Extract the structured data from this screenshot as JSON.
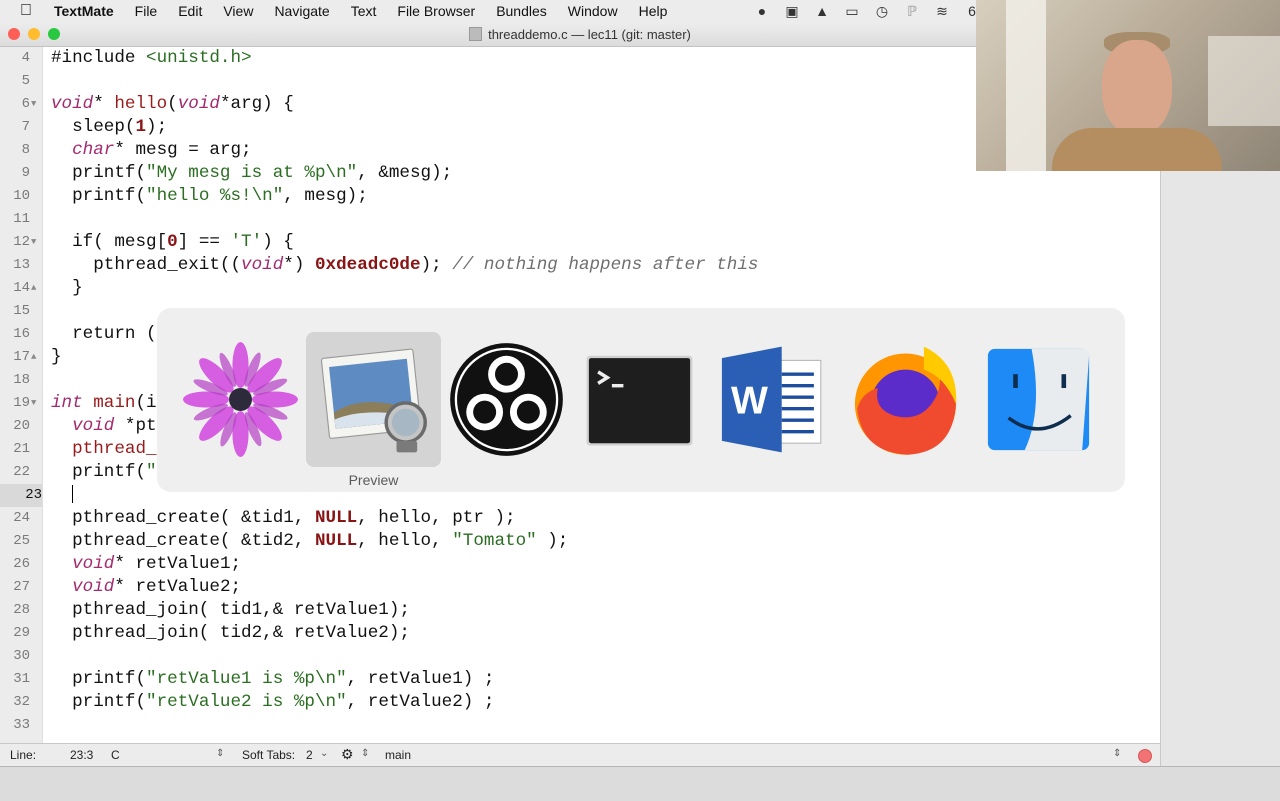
{
  "menubar": {
    "app_name": "TextMate",
    "items": [
      "File",
      "Edit",
      "View",
      "Navigate",
      "Text",
      "File Browser",
      "Bundles",
      "Window",
      "Help"
    ],
    "tray_icons": [
      "opera-icon",
      "docker-icon",
      "airplay-icon",
      "screen-icon",
      "time-machine-icon",
      "bluetooth-icon",
      "wifi-icon"
    ],
    "battery_fragment": "6"
  },
  "window": {
    "title": "threaddemo.c — lec11 (git: master)"
  },
  "editor": {
    "current_line": 23,
    "lines": [
      {
        "n": "4",
        "fold": "",
        "html": "#include <span class='str'>&lt;unistd.h&gt;</span>"
      },
      {
        "n": "5",
        "fold": "",
        "html": ""
      },
      {
        "n": "6",
        "fold": "▼",
        "html": "<span class='kw'>void</span>* <span class='fn'>hello</span>(<span class='kw'>void</span>*arg) {"
      },
      {
        "n": "7",
        "fold": "",
        "html": "  sleep(<span class='num'>1</span>);"
      },
      {
        "n": "8",
        "fold": "",
        "html": "  <span class='kw'>char</span>* mesg = arg;"
      },
      {
        "n": "9",
        "fold": "",
        "html": "  printf(<span class='str'>\"My mesg is at </span><span class='str'>%p\\n\"</span>, &amp;mesg);"
      },
      {
        "n": "10",
        "fold": "",
        "html": "  printf(<span class='str'>\"hello %s!\\n\"</span>, mesg);"
      },
      {
        "n": "11",
        "fold": "",
        "html": ""
      },
      {
        "n": "12",
        "fold": "▼",
        "html": "  if( mesg[<span class='num'>0</span>] == <span class='str'>'T'</span>) {"
      },
      {
        "n": "13",
        "fold": "",
        "html": "    pthread_exit((<span class='kw'>void</span>*) <span class='num'>0xdeadc0de</span>); <span class='cm'>// nothing happens after this</span>"
      },
      {
        "n": "14",
        "fold": "▲",
        "html": "  }"
      },
      {
        "n": "15",
        "fold": "",
        "html": ""
      },
      {
        "n": "16",
        "fold": "",
        "html": "  return ("
      },
      {
        "n": "17",
        "fold": "▲",
        "html": "}"
      },
      {
        "n": "18",
        "fold": "",
        "html": ""
      },
      {
        "n": "19",
        "fold": "▼",
        "html": "<span class='kw'>int</span> <span class='fn'>main</span>(i"
      },
      {
        "n": "20",
        "fold": "",
        "html": "  <span class='kw'>void</span> *pt"
      },
      {
        "n": "21",
        "fold": "",
        "html": "  <span class='fn'>pthread_</span>"
      },
      {
        "n": "22",
        "fold": "",
        "html": "  printf(<span class='str'>\"</span>"
      },
      {
        "n": "23",
        "fold": "",
        "html": "  <span class='caret'></span>"
      },
      {
        "n": "24",
        "fold": "",
        "html": "  pthread_create( &amp;tid1, <span class='num'>NULL</span>, hello, ptr );"
      },
      {
        "n": "25",
        "fold": "",
        "html": "  pthread_create( &amp;tid2, <span class='num'>NULL</span>, hello, <span class='str'>\"Tomato\"</span> );"
      },
      {
        "n": "26",
        "fold": "",
        "html": "  <span class='kw'>void</span>* retValue1;"
      },
      {
        "n": "27",
        "fold": "",
        "html": "  <span class='kw'>void</span>* retValue2;"
      },
      {
        "n": "28",
        "fold": "",
        "html": "  pthread_join( tid1,&amp; retValue1);"
      },
      {
        "n": "29",
        "fold": "",
        "html": "  pthread_join( tid2,&amp; retValue2);"
      },
      {
        "n": "30",
        "fold": "",
        "html": ""
      },
      {
        "n": "31",
        "fold": "",
        "html": "  printf(<span class='str'>\"retValue1 is %p\\n\"</span>, retValue1) ;"
      },
      {
        "n": "32",
        "fold": "",
        "html": "  printf(<span class='str'>\"retValue2 is %p\\n\"</span>, retValue2) ;"
      },
      {
        "n": "33",
        "fold": "",
        "html": ""
      }
    ]
  },
  "statusbar": {
    "line_label": "Line:",
    "position": "23:3",
    "language": "C",
    "tabs_label": "Soft Tabs:",
    "tab_size": "2",
    "symbol": "main"
  },
  "app_switcher": {
    "apps": [
      "osiris-icon",
      "preview-icon",
      "obs-icon",
      "terminal-icon",
      "word-icon",
      "firefox-icon",
      "finder-icon"
    ],
    "selected_index": 1,
    "selected_name": "Preview"
  },
  "colors": {
    "keyword": "#a32a6e",
    "function": "#9a1b1b",
    "string": "#2b6e22",
    "number": "#8a1414",
    "comment": "#6f6f6f",
    "traffic_close": "#fd5f57",
    "traffic_min": "#febc2e",
    "traffic_max": "#28c840"
  }
}
